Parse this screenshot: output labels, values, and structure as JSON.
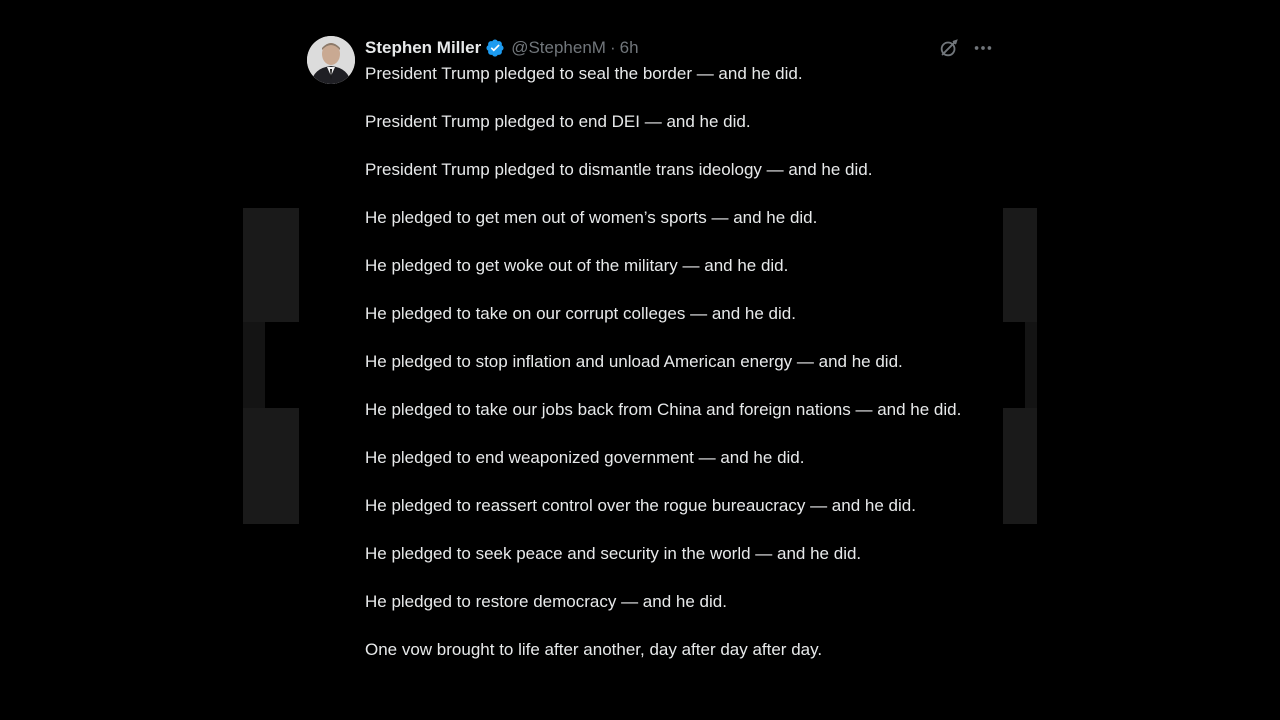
{
  "post": {
    "display_name": "Stephen Miller",
    "handle": "@StephenM",
    "separator": "·",
    "time": "6h",
    "verified_icon": "verified-badge-icon",
    "colors": {
      "background": "#000000",
      "text": "#e7e9ea",
      "muted": "#71767b",
      "verified": "#1d9bf0"
    },
    "paragraphs": [
      "President Trump pledged to seal the border — and he did.",
      "President Trump pledged to end DEI — and he did.",
      "President Trump pledged to dismantle trans ideology — and he did.",
      "He pledged to get men out of women’s sports — and he did.",
      "He pledged to get woke out of the military — and he did.",
      "He pledged to take on our corrupt colleges — and he did.",
      "He pledged to stop inflation and unload American energy — and he did.",
      "He pledged to take our jobs back from China and foreign nations — and he did.",
      "He pledged to end weaponized government — and he did.",
      "He pledged to reassert control over the rogue bureaucracy — and he did.",
      "He pledged to seek peace and security in the world — and he did.",
      "He pledged to restore democracy — and he did.",
      "One vow brought to life after another, day after day after day."
    ]
  }
}
